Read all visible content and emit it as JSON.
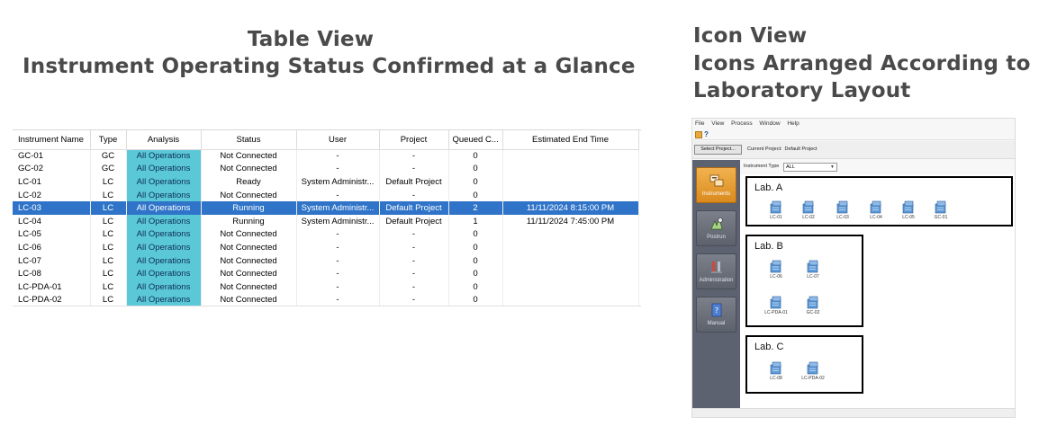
{
  "headings": {
    "table_view_title": "Table View",
    "table_view_subtitle": "Instrument Operating Status Confirmed at a Glance",
    "icon_view_title": "Icon View",
    "icon_view_line1": "Icons Arranged According to",
    "icon_view_line2": "Laboratory Layout"
  },
  "table": {
    "columns": [
      "Instrument Name",
      "Type",
      "Analysis",
      "Status",
      "User",
      "Project",
      "Queued C...",
      "Estimated End Time"
    ],
    "selected_row": 4,
    "rows": [
      {
        "name": "GC-01",
        "type": "GC",
        "analysis": "All Operations",
        "status": "Not Connected",
        "user": "-",
        "project": "-",
        "queued": "0",
        "end": ""
      },
      {
        "name": "GC-02",
        "type": "GC",
        "analysis": "All Operations",
        "status": "Not Connected",
        "user": "-",
        "project": "-",
        "queued": "0",
        "end": ""
      },
      {
        "name": "LC-01",
        "type": "LC",
        "analysis": "All Operations",
        "status": "Ready",
        "user": "System Administr...",
        "project": "Default Project",
        "queued": "0",
        "end": ""
      },
      {
        "name": "LC-02",
        "type": "LC",
        "analysis": "All Operations",
        "status": "Not Connected",
        "user": "-",
        "project": "-",
        "queued": "0",
        "end": ""
      },
      {
        "name": "LC-03",
        "type": "LC",
        "analysis": "All Operations",
        "status": "Running",
        "user": "System Administr...",
        "project": "Default Project",
        "queued": "2",
        "end": "11/11/2024 8:15:00 PM"
      },
      {
        "name": "LC-04",
        "type": "LC",
        "analysis": "All Operations",
        "status": "Running",
        "user": "System Administr...",
        "project": "Default Project",
        "queued": "1",
        "end": "11/11/2024 7:45:00 PM"
      },
      {
        "name": "LC-05",
        "type": "LC",
        "analysis": "All Operations",
        "status": "Not Connected",
        "user": "-",
        "project": "-",
        "queued": "0",
        "end": ""
      },
      {
        "name": "LC-06",
        "type": "LC",
        "analysis": "All Operations",
        "status": "Not Connected",
        "user": "-",
        "project": "-",
        "queued": "0",
        "end": ""
      },
      {
        "name": "LC-07",
        "type": "LC",
        "analysis": "All Operations",
        "status": "Not Connected",
        "user": "-",
        "project": "-",
        "queued": "0",
        "end": ""
      },
      {
        "name": "LC-08",
        "type": "LC",
        "analysis": "All Operations",
        "status": "Not Connected",
        "user": "-",
        "project": "-",
        "queued": "0",
        "end": ""
      },
      {
        "name": "LC-PDA-01",
        "type": "LC",
        "analysis": "All Operations",
        "status": "Not Connected",
        "user": "-",
        "project": "-",
        "queued": "0",
        "end": ""
      },
      {
        "name": "LC-PDA-02",
        "type": "LC",
        "analysis": "All Operations",
        "status": "Not Connected",
        "user": "-",
        "project": "-",
        "queued": "0",
        "end": ""
      }
    ]
  },
  "icon_view": {
    "menu": [
      "File",
      "View",
      "Process",
      "Window",
      "Help"
    ],
    "toolbar_help": "?",
    "select_project_label": "Select Project...",
    "current_project_label": "Current Project:",
    "current_project_value": "Default Project",
    "instrument_type_label": "Instrument Type",
    "instrument_type_value": "ALL",
    "sidebar": [
      {
        "label": "Instruments",
        "icon": "instruments-icon",
        "active": true
      },
      {
        "label": "Postrun",
        "icon": "postrun-icon",
        "active": false
      },
      {
        "label": "Administration",
        "icon": "administration-icon",
        "active": false
      },
      {
        "label": "Manual",
        "icon": "manual-icon",
        "active": false
      }
    ],
    "labs": [
      {
        "title": "Lab. A",
        "instruments": [
          "LC-01",
          "LC-02",
          "LC-03",
          "LC-04",
          "LC-05",
          "GC-01"
        ]
      },
      {
        "title": "Lab. B",
        "instruments": [
          "LC-06",
          "LC-07",
          "LC-PDA-01",
          "GC-02"
        ]
      },
      {
        "title": "Lab. C",
        "instruments": [
          "LC-08",
          "LC-PDA-02"
        ]
      }
    ]
  },
  "colors": {
    "analysis_cell": "#5bc8d8",
    "selected_row": "#2f74c8",
    "heading_text": "#4a4a4a",
    "sidebar_bg": "#5c6270",
    "sidebar_active": "#e9a23a",
    "instrument_icon": "#5f9bd8"
  }
}
